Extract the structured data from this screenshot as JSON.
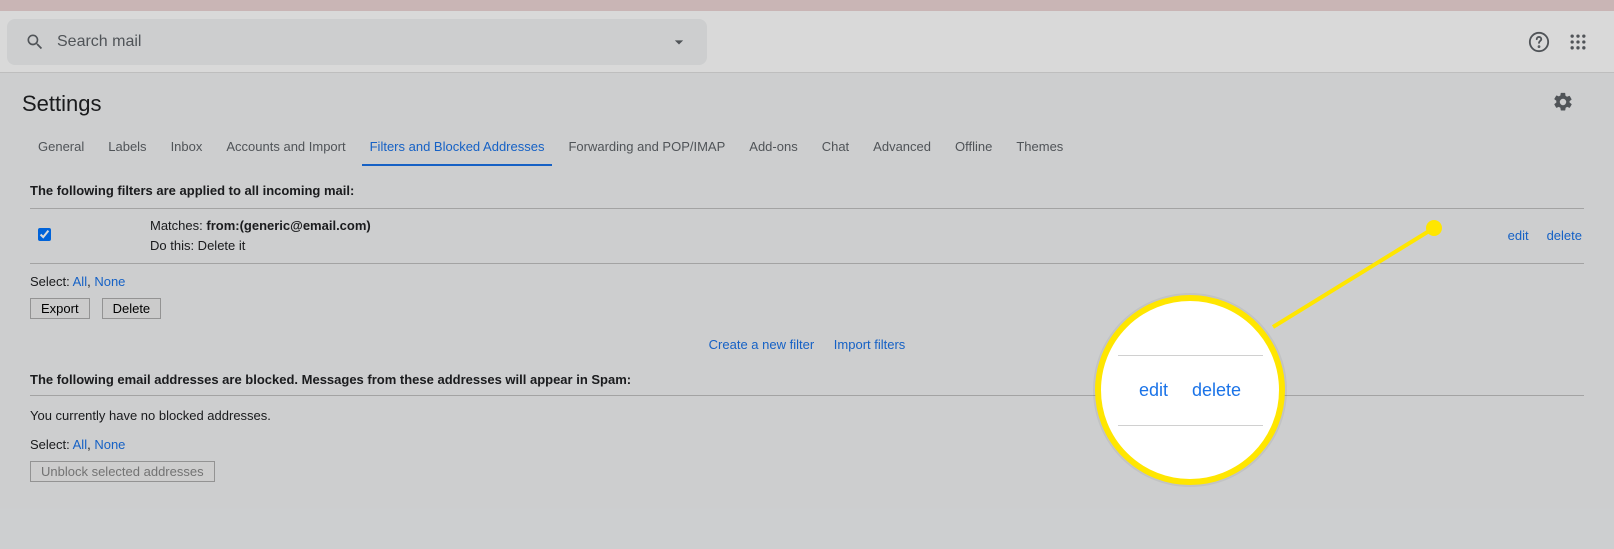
{
  "search": {
    "placeholder": "Search mail"
  },
  "page": {
    "title": "Settings"
  },
  "tabs": [
    {
      "label": "General"
    },
    {
      "label": "Labels"
    },
    {
      "label": "Inbox"
    },
    {
      "label": "Accounts and Import"
    },
    {
      "label": "Filters and Blocked Addresses"
    },
    {
      "label": "Forwarding and POP/IMAP"
    },
    {
      "label": "Add-ons"
    },
    {
      "label": "Chat"
    },
    {
      "label": "Advanced"
    },
    {
      "label": "Offline"
    },
    {
      "label": "Themes"
    }
  ],
  "filters": {
    "heading": "The following filters are applied to all incoming mail:",
    "row": {
      "matches_label": "Matches: ",
      "matches_value": "from:(generic@email.com)",
      "action": "Do this: Delete it",
      "edit": "edit",
      "delete": "delete"
    },
    "select_label": "Select: ",
    "select_all": "All",
    "select_none": "None",
    "export_btn": "Export",
    "delete_btn": "Delete",
    "create_link": "Create a new filter",
    "import_link": "Import filters"
  },
  "blocked": {
    "heading": "The following email addresses are blocked. Messages from these addresses will appear in Spam:",
    "none_msg": "You currently have no blocked addresses.",
    "select_label": "Select: ",
    "select_all": "All",
    "select_none": "None",
    "unblock_btn": "Unblock selected addresses"
  },
  "callout": {
    "edit": "edit",
    "delete": "delete"
  },
  "colors": {
    "link": "#1a73e8",
    "highlight": "#ffe600"
  }
}
